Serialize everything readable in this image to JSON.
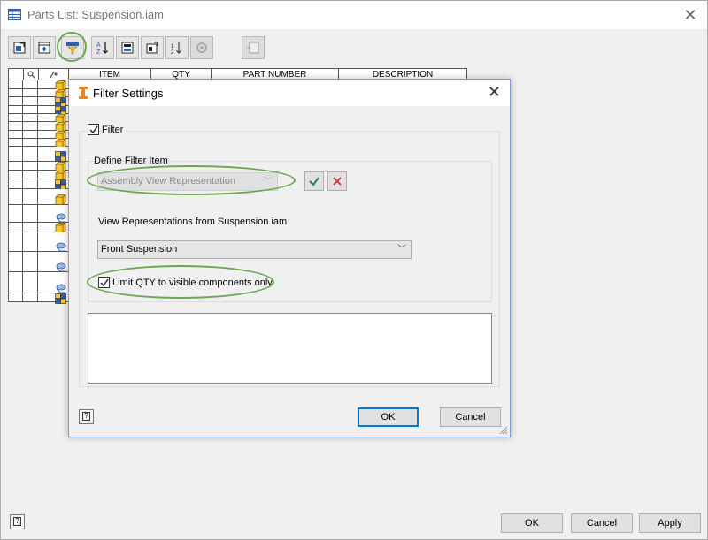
{
  "window": {
    "title": "Parts List: Suspension.iam",
    "close_glyph": "✕"
  },
  "toolbar": {
    "buttons": [
      {
        "name": "member-selection-icon"
      },
      {
        "name": "add-row-icon"
      },
      {
        "name": "filter-settings-icon"
      },
      {
        "name": "sort-icon"
      },
      {
        "name": "export-icon"
      },
      {
        "name": "table-wrap-icon"
      },
      {
        "name": "renumber-icon"
      },
      {
        "name": "part-number-merge-icon"
      },
      {
        "name": "view-bom-icon"
      }
    ]
  },
  "grid": {
    "columns": [
      "ITEM",
      "QTY",
      "PART NUMBER",
      "DESCRIPTION"
    ],
    "rows": [
      {
        "icon": "part"
      },
      {
        "icon": "part"
      },
      {
        "icon": "assembly"
      },
      {
        "icon": "assembly"
      },
      {
        "icon": "part"
      },
      {
        "icon": "part"
      },
      {
        "icon": "part"
      },
      {
        "icon": "part"
      },
      {
        "icon": "assembly"
      },
      {
        "icon": "part"
      },
      {
        "icon": "part"
      },
      {
        "icon": "assembly"
      },
      {
        "icon": "part"
      },
      {
        "icon": "content"
      },
      {
        "icon": "part"
      },
      {
        "icon": "content"
      },
      {
        "icon": "content"
      },
      {
        "icon": "content"
      },
      {
        "icon": "assembly"
      }
    ]
  },
  "footer": {
    "ok": "OK",
    "cancel": "Cancel",
    "apply": "Apply",
    "help": "?"
  },
  "dialog": {
    "title": "Filter Settings",
    "close_glyph": "✕",
    "filter_label": "Filter",
    "filter_checked": true,
    "define_label": "Define Filter Item",
    "filter_item_value": "Assembly View Representation",
    "reps_label": "View Representations from Suspension.iam",
    "rep_value": "Front Suspension",
    "limit_label": "Limit QTY to visible components only",
    "limit_checked": true,
    "ok": "OK",
    "cancel": "Cancel",
    "help": "?"
  },
  "colors": {
    "highlight": "#6aa84f",
    "accent": "#0078d7",
    "cube_yellow": "#f7c531",
    "assembly_blue": "#2f5fb0",
    "checkmark_teal": "#2a7f7a",
    "delete_red": "#d0313a"
  }
}
